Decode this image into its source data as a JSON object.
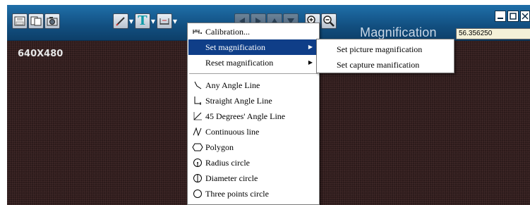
{
  "window": {
    "resolution_label": "640X480",
    "magnification_label": "Magnification",
    "magnification_value": "56.356250"
  },
  "toolbar": {
    "icons": [
      "disk-icon",
      "copy-icon",
      "camera-icon",
      "pencil-icon",
      "text-tool-icon",
      "measure-ruler-icon",
      "arrow-left-icon",
      "arrow-right-icon",
      "arrow-up-icon",
      "arrow-down-icon",
      "zoom-in-icon",
      "zoom-out-icon"
    ]
  },
  "context_menu": {
    "items": [
      {
        "label": "Calibration...",
        "icon": "calibration-icon"
      },
      {
        "label": "Set magnification",
        "icon": "",
        "has_submenu": true
      },
      {
        "label": "Reset magnification",
        "icon": "",
        "has_submenu": true
      },
      {
        "label": "Any Angle Line",
        "icon": "any-angle-line-icon"
      },
      {
        "label": "Straight Angle Line",
        "icon": "straight-angle-line-icon"
      },
      {
        "label": "45 Degrees' Angle Line",
        "icon": "45-degrees-line-icon"
      },
      {
        "label": "Continuous line",
        "icon": "continuous-line-icon"
      },
      {
        "label": "Polygon",
        "icon": "polygon-icon"
      },
      {
        "label": "Radius circle",
        "icon": "radius-circle-icon"
      },
      {
        "label": "Diameter circle",
        "icon": "diameter-circle-icon"
      },
      {
        "label": "Three points circle",
        "icon": "three-points-circle-icon"
      }
    ]
  },
  "submenu": {
    "items": [
      {
        "label": "Set picture magnification"
      },
      {
        "label": "Set capture manification"
      }
    ]
  },
  "colors": {
    "toolbar": "#124f80",
    "highlight": "#0f3e88",
    "canvas": "#2b1a1a"
  }
}
